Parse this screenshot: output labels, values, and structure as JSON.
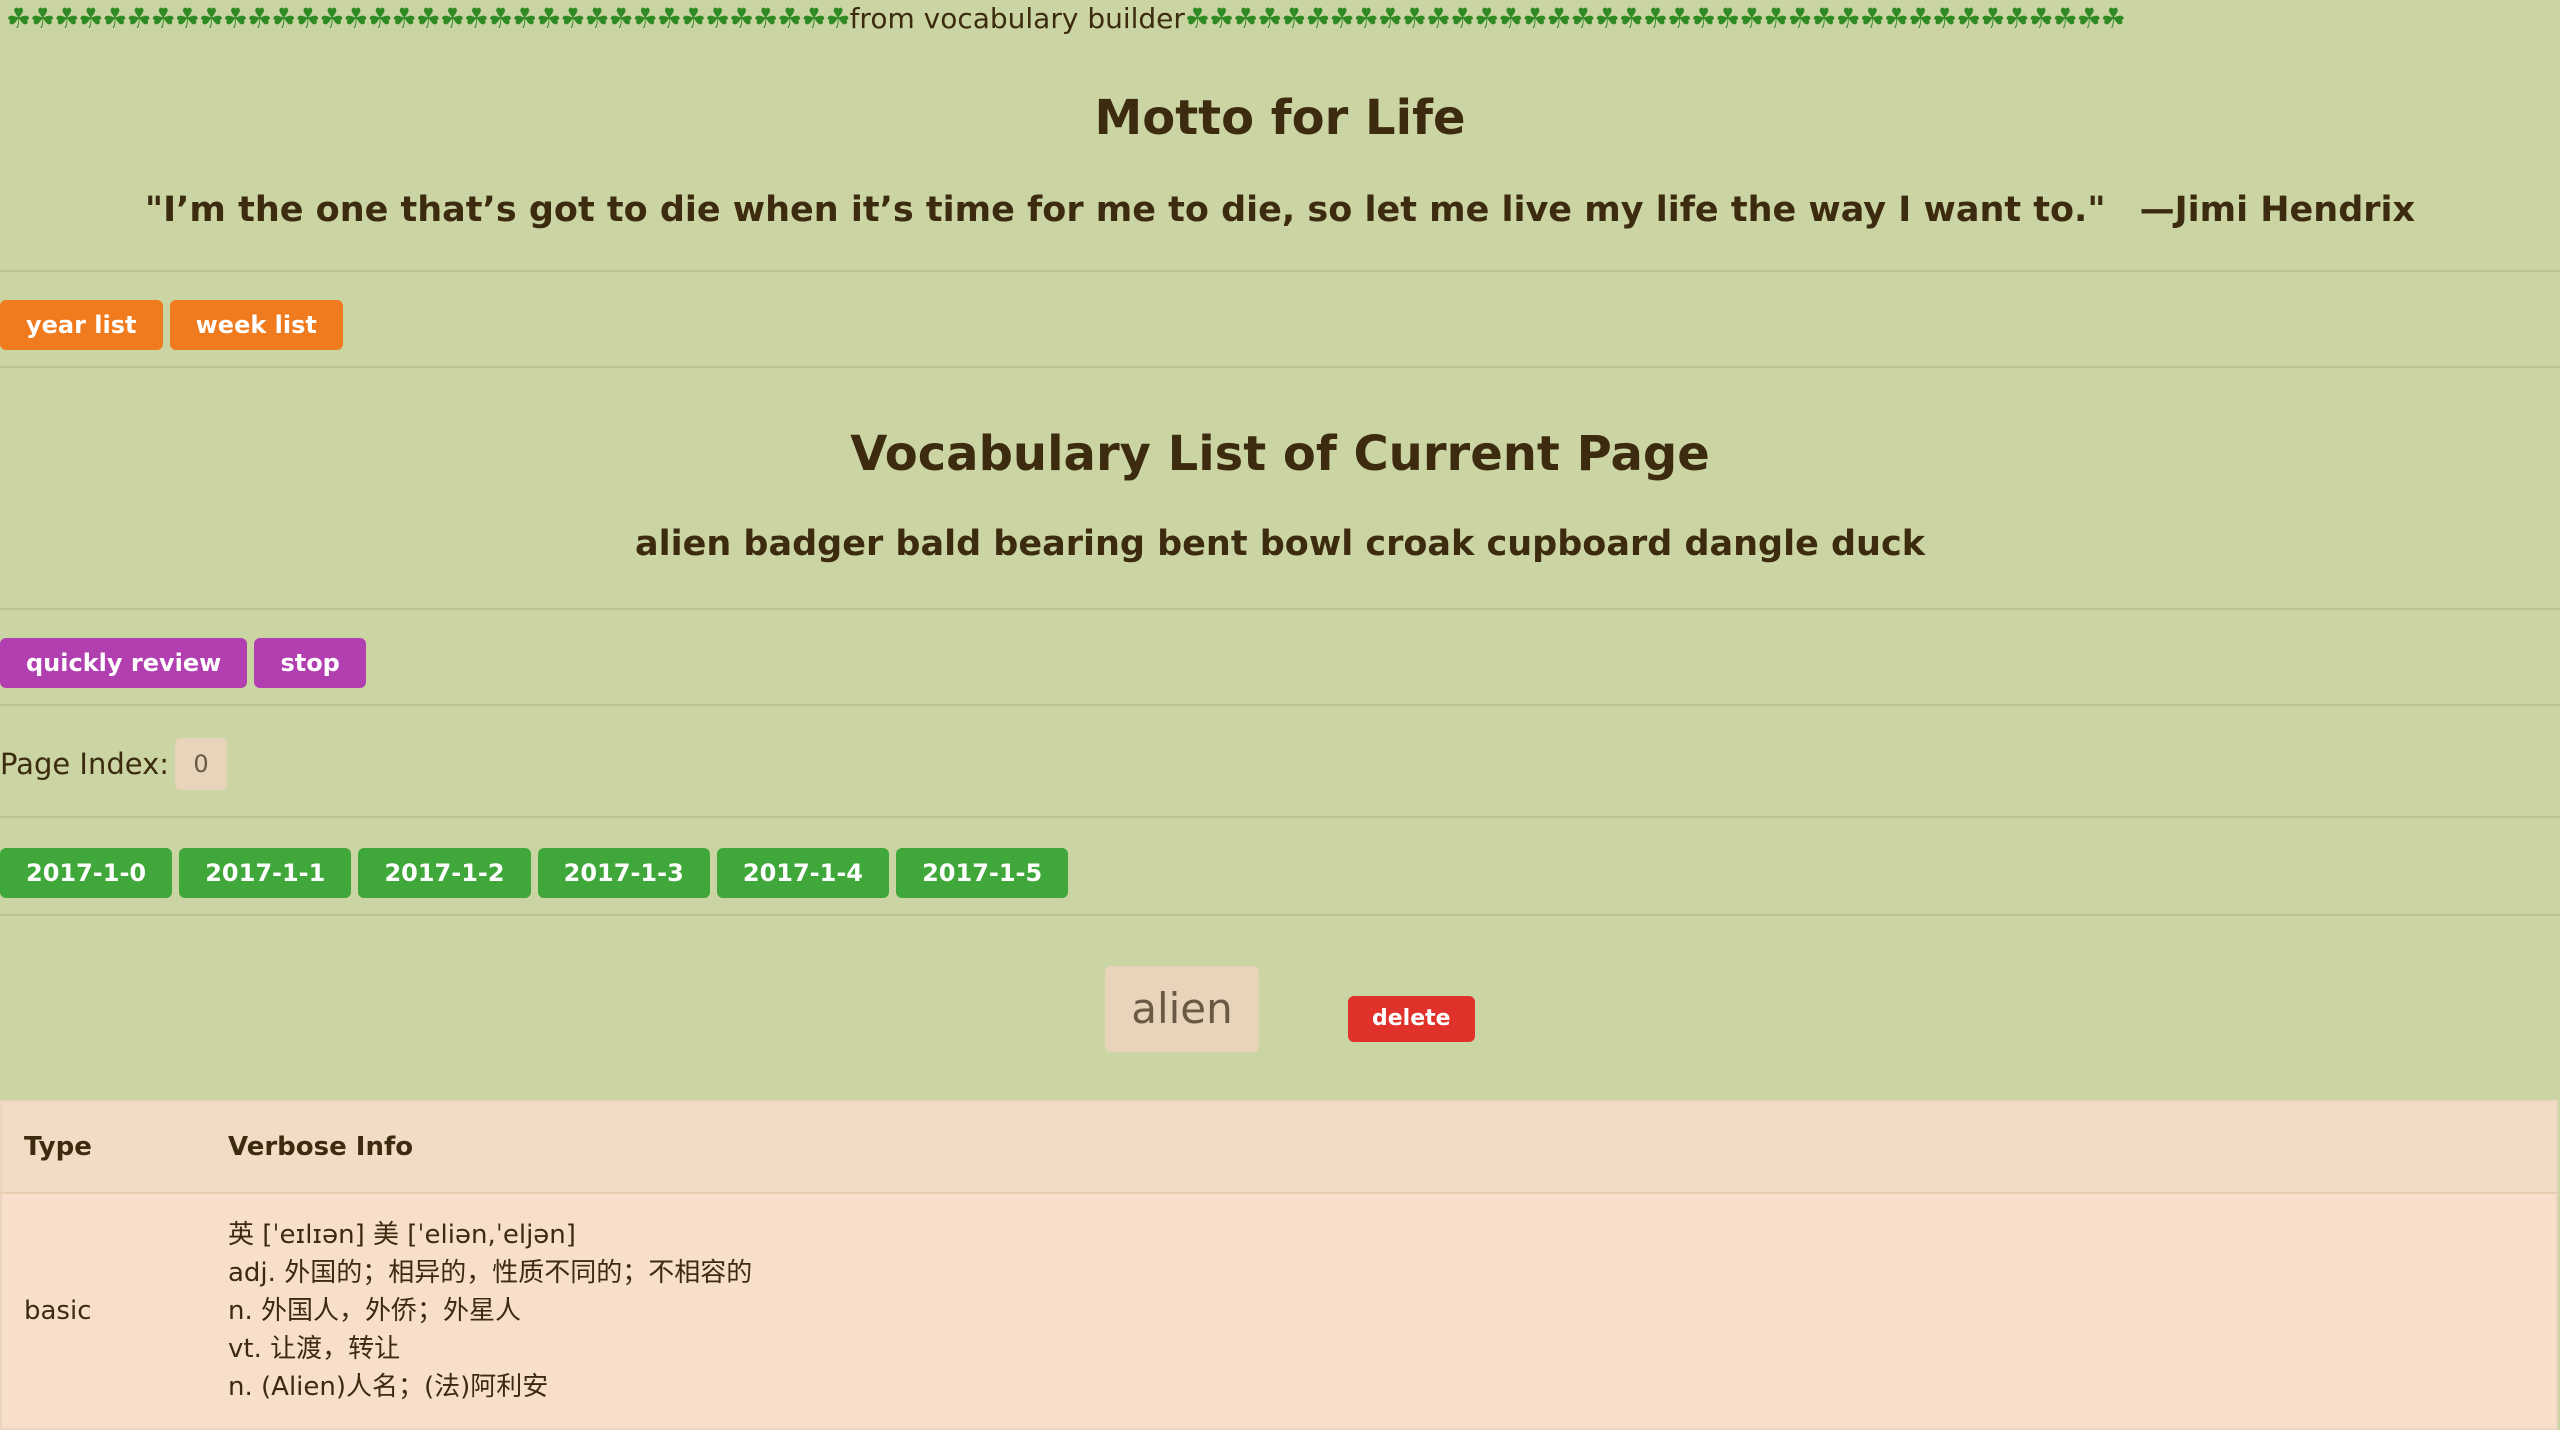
{
  "banner": {
    "clovers_left": "☘☘☘☘☘☘☘☘☘☘☘☘☘☘☘☘☘☘☘☘☘☘☘☘☘☘☘☘☘☘☘☘☘☘☘",
    "text": "from vocabulary builder",
    "clovers_right": "☘☘☘☘☘☘☘☘☘☘☘☘☘☘☘☘☘☘☘☘☘☘☘☘☘☘☘☘☘☘☘☘☘☘☘☘☘☘☘"
  },
  "motto": {
    "title": "Motto for Life",
    "quote": "\"I’m the one that’s got to die when it’s time for me to die, so let me live my life the way I want to.\"",
    "author": "—Jimi Hendrix"
  },
  "list_buttons": {
    "year": "year list",
    "week": "week list"
  },
  "vocab": {
    "title": "Vocabulary List of Current Page",
    "words": "alien badger bald bearing bent bowl croak cupboard dangle duck"
  },
  "review_buttons": {
    "quick_review": "quickly review",
    "stop": "stop"
  },
  "page_index": {
    "label": "Page Index:",
    "value": "0"
  },
  "dates": [
    "2017-1-0",
    "2017-1-1",
    "2017-1-2",
    "2017-1-3",
    "2017-1-4",
    "2017-1-5"
  ],
  "current": {
    "word": "alien",
    "delete_label": "delete"
  },
  "table": {
    "headers": {
      "type": "Type",
      "verbose": "Verbose Info"
    },
    "rows": [
      {
        "type": "basic",
        "lines": [
          "英 [ˈeɪlɪən] 美 [ˈeliən,ˈeljən]",
          "adj. 外国的；相异的，性质不同的；不相容的",
          "n. 外国人，外侨；外星人",
          "vt. 让渡，转让",
          "n. (Alien)人名；(法)阿利安"
        ]
      }
    ]
  },
  "colors": {
    "background": "#cbd5a3",
    "orange": "#f07a1e",
    "purple": "#b23fb0",
    "green": "#40a83a",
    "red": "#e0322a"
  }
}
